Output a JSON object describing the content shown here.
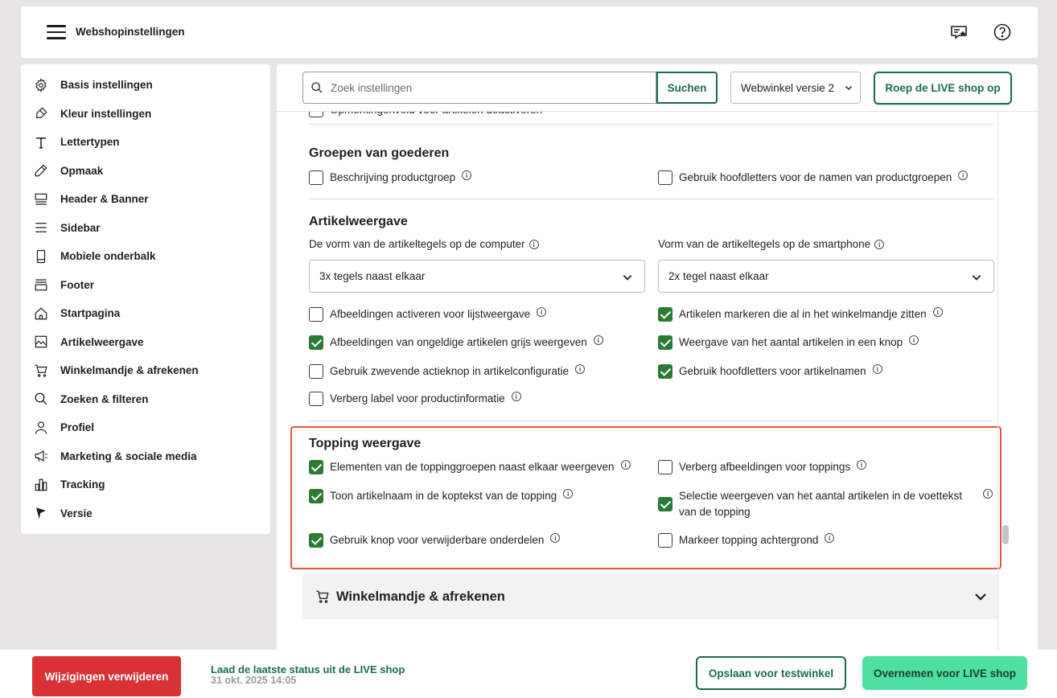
{
  "header": {
    "title": "Webshopinstellingen",
    "icons": [
      "menu-icon",
      "review-star-icon",
      "help-icon"
    ]
  },
  "sidebar": {
    "items": [
      {
        "label": "Basis instellingen",
        "icon": "gear-icon"
      },
      {
        "label": "Kleur instellingen",
        "icon": "paint-brush-icon"
      },
      {
        "label": "Lettertypen",
        "icon": "text-t-icon"
      },
      {
        "label": "Opmaak",
        "icon": "pencil-icon"
      },
      {
        "label": "Header & Banner",
        "icon": "header-layout-icon"
      },
      {
        "label": "Sidebar",
        "icon": "list-lines-icon"
      },
      {
        "label": "Mobiele onderbalk",
        "icon": "mobile-icon"
      },
      {
        "label": "Footer",
        "icon": "footer-layout-icon"
      },
      {
        "label": "Startpagina",
        "icon": "home-icon"
      },
      {
        "label": "Artikelweergave",
        "icon": "image-icon"
      },
      {
        "label": "Winkelmandje & afrekenen",
        "icon": "cart-icon"
      },
      {
        "label": "Zoeken & filteren",
        "icon": "search-icon"
      },
      {
        "label": "Profiel",
        "icon": "user-icon"
      },
      {
        "label": "Marketing & sociale media",
        "icon": "megaphone-icon"
      },
      {
        "label": "Tracking",
        "icon": "bar-chart-icon"
      },
      {
        "label": "Versie",
        "icon": "version-flag-icon"
      }
    ]
  },
  "toolbar": {
    "search_placeholder": "Zoek instellingen",
    "search_value": "",
    "search_button": "Suchen",
    "version_selected": "Webwinkel versie 2",
    "live_button": "Roep de LIVE shop op"
  },
  "content": {
    "cutoff_option": "Opmerkingenveld voor artikelen deactiveren",
    "groepen": {
      "title": "Groepen van goederen",
      "options": [
        {
          "label": "Beschrijving productgroep",
          "checked": false
        },
        {
          "label": "Gebruik hoofdletters voor de namen van productgroepen",
          "checked": false
        }
      ]
    },
    "artikel": {
      "title": "Artikelweergave",
      "desktop_label": "De vorm van de artikeltegels op de computer",
      "desktop_value": "3x tegels naast elkaar",
      "mobile_label": "Vorm van de artikeltegels op de smartphone",
      "mobile_value": "2x tegel naast elkaar",
      "options": [
        {
          "label": "Afbeeldingen activeren voor lijstweergave",
          "checked": false
        },
        {
          "label": "Artikelen markeren die al in het winkelmandje zitten",
          "checked": true
        },
        {
          "label": "Afbeeldingen van ongeldige artikelen grijs weergeven",
          "checked": true
        },
        {
          "label": "Weergave van het aantal artikelen in een knop",
          "checked": true
        },
        {
          "label": "Gebruik zwevende actieknop in artikelconfiguratie",
          "checked": false
        },
        {
          "label": "Gebruik hoofdletters voor artikelnamen",
          "checked": true
        },
        {
          "label": "Verberg label voor productinformatie",
          "checked": false
        }
      ]
    },
    "topping": {
      "title": "Topping weergave",
      "options": [
        {
          "label": "Elementen van de toppinggroepen naast elkaar weergeven",
          "checked": true
        },
        {
          "label": "Verberg afbeeldingen voor toppings",
          "checked": false
        },
        {
          "label": "Toon artikelnaam in de koptekst van de topping",
          "checked": true
        },
        {
          "label": "Selectie weergeven van het aantal artikelen in de voettekst van de topping",
          "checked": true
        },
        {
          "label": "Gebruik knop voor verwijderbare onderdelen",
          "checked": true
        },
        {
          "label": "Markeer topping achtergrond",
          "checked": false
        }
      ]
    },
    "accordion_title": "Winkelmandje & afrekenen",
    "info_glyph": "i"
  },
  "footer": {
    "delete_button": "Wijzigingen verwijderen",
    "status_link": "Laad de laatste status uit de LIVE shop",
    "status_time": "31 okt. 2025 14:05",
    "save_test_button": "Opslaan voor testwinkel",
    "take_live_button": "Overnemen voor LIVE shop"
  },
  "colors": {
    "accent": "#1c6b4f",
    "checkbox": "#2b7a36",
    "danger": "#d93236",
    "highlight": "#e5553f",
    "live": "#4ee0a2"
  }
}
